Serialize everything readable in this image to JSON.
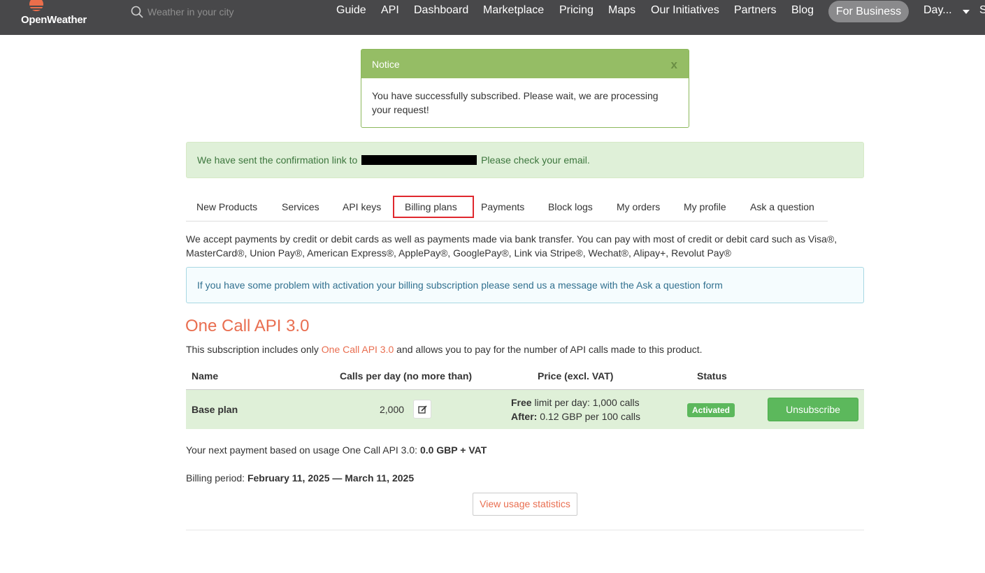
{
  "header": {
    "logo_text": "OpenWeather",
    "search_placeholder": "Weather in your city",
    "nav": [
      "Guide",
      "API",
      "Dashboard",
      "Marketplace",
      "Pricing",
      "Maps",
      "Our Initiatives",
      "Partners",
      "Blog"
    ],
    "for_business": "For Business",
    "user_menu": "Day...",
    "cut_item": "S"
  },
  "notice": {
    "title": "Notice",
    "close": "x",
    "body": "You have successfully subscribed. Please wait, we are processing your request!"
  },
  "confirm": {
    "before": "We have sent the confirmation link to",
    "after": "Please check your email."
  },
  "tabs": [
    "New Products",
    "Services",
    "API keys",
    "Billing plans",
    "Payments",
    "Block logs",
    "My orders",
    "My profile",
    "Ask a question"
  ],
  "active_tab": "Billing plans",
  "payment_info": "We accept payments by credit or debit cards as well as payments made via bank transfer. You can pay with most of credit or debit card such as Visa®, MasterCard®, Union Pay®, American Express®, ApplePay®, GooglePay®, Link via Stripe®, Wechat®, Alipay+, Revolut Pay®",
  "info_alert": "If you have some problem with activation your billing subscription please send us a message with the Ask a question form",
  "section": {
    "title": "One Call API 3.0",
    "sub_before": "This subscription includes only",
    "sub_link": "One Call API 3.0",
    "sub_after": "and allows you to pay for the number of API calls made to this product."
  },
  "table": {
    "headers": [
      "Name",
      "Calls per day (no more than)",
      "Price (excl. VAT)",
      "Status"
    ],
    "row": {
      "name": "Base plan",
      "calls": "2,000",
      "price_line1_bold": "Free",
      "price_line1": "limit per day: 1,000 calls",
      "price_line2_bold": "After:",
      "price_line2": "0.12 GBP per 100 calls",
      "status": "Activated",
      "action": "Unsubscribe"
    }
  },
  "next_payment": {
    "label": "Your next payment based on usage One Call API 3.0:",
    "value": "0.0 GBP + VAT"
  },
  "billing_period": {
    "label": "Billing period:",
    "value": "February 11, 2025 — March 11, 2025"
  },
  "usage_button": "View usage statistics",
  "colors": {
    "header_bg": "#48484a",
    "accent": "#e96e50",
    "success": "#5cb85c",
    "notice_green": "#95bd65",
    "active_tab_outline": "#e0282e"
  }
}
